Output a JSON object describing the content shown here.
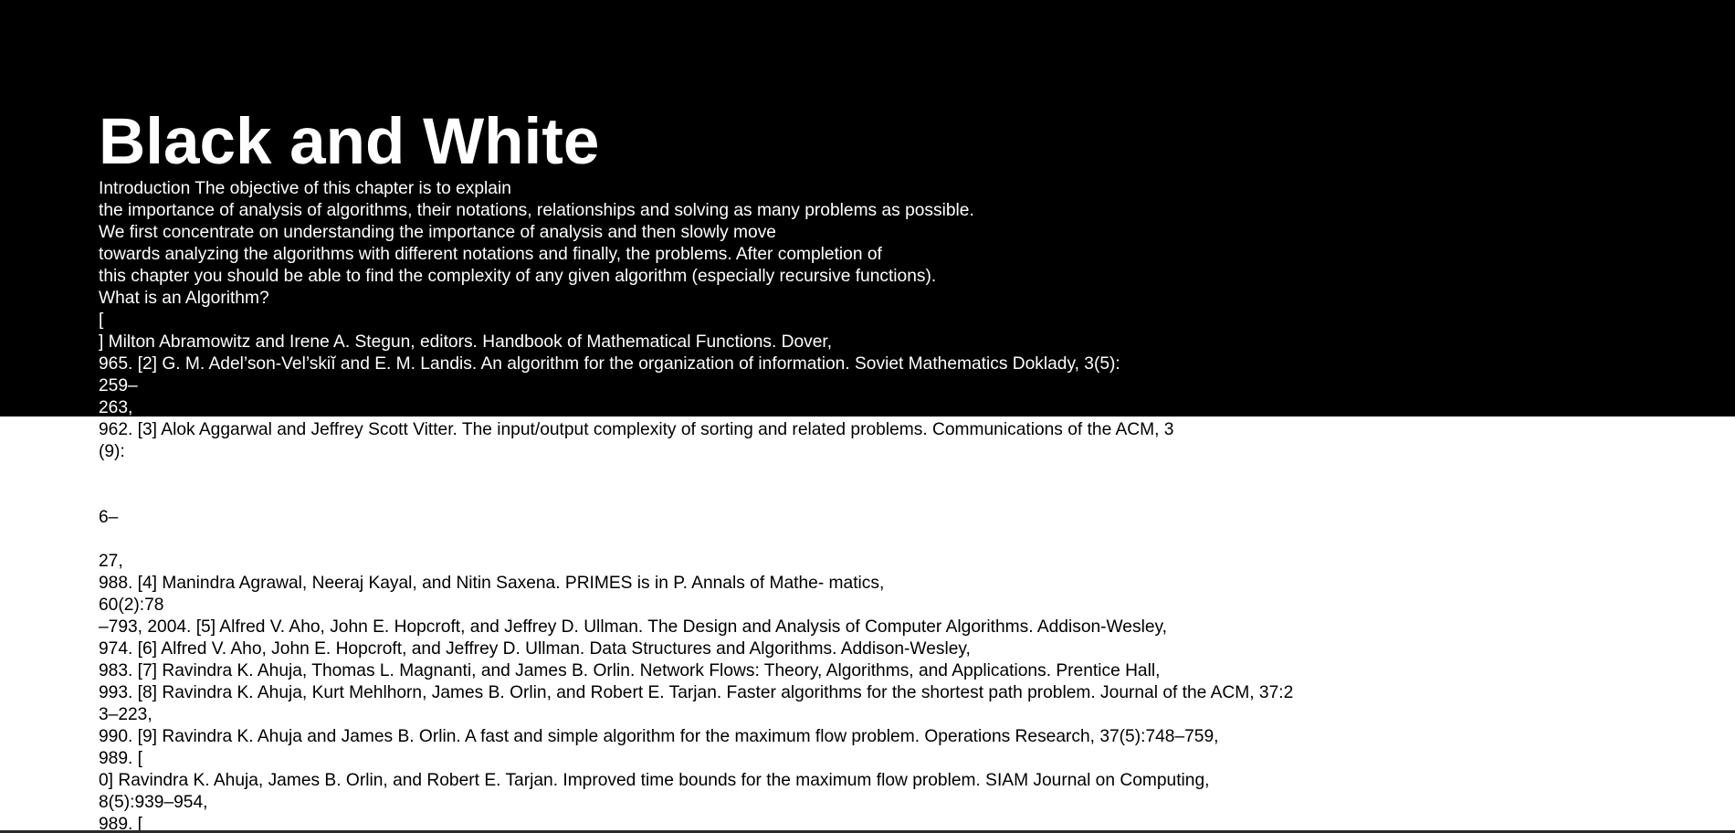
{
  "title": "Black and White",
  "colors": {
    "hero_background": "#000000",
    "hero_text": "#ffffff",
    "page_background": "#ffffff",
    "page_text": "#000000"
  },
  "lines": [
    "Introduction The objective of this chapter is to explain",
    "the importance of analysis of algorithms, their notations, relationships and solving as many problems as possible.",
    "We first concentrate on understanding the importance of analysis and then slowly move",
    "towards analyzing the algorithms with different notations and finally, the problems. After completion of",
    "this chapter you should be able to find the complexity of any given algorithm (especially recursive functions).",
    "What is an Algorithm?",
    "[",
    "] Milton Abramowitz and Irene A. Stegun, editors. Handbook of Mathematical Functions. Dover,",
    "965. [2] G. M. Adel’son-Vel’skiĭ and E. M. Landis. An algorithm for the organization of information. Soviet Mathematics Doklady, 3(5):",
    "259–",
    "263,",
    "962. [3] Alok Aggarwal and Jeffrey Scott Vitter. The input/output complexity of sorting and related problems. Communications of the ACM, 3",
    "(9):",
    "",
    "",
    "6–",
    "",
    "27,",
    "988. [4] Manindra Agrawal, Neeraj Kayal, and Nitin Saxena. PRIMES is in P. Annals of Mathe- matics,",
    "60(2):78",
    "–793, 2004. [5] Alfred V. Aho, John E. Hopcroft, and Jeffrey D. Ullman. The Design and Analysis of Computer Algorithms. Addison-Wesley,",
    "974. [6] Alfred V. Aho, John E. Hopcroft, and Jeffrey D. Ullman. Data Structures and Algorithms. Addison-Wesley,",
    "983. [7] Ravindra K. Ahuja, Thomas L. Magnanti, and James B. Orlin. Network Flows: Theory, Algorithms, and Applications. Prentice Hall,",
    "993. [8] Ravindra K. Ahuja, Kurt Mehlhorn, James B. Orlin, and Robert E. Tarjan. Faster algorithms for the shortest path problem. Journal of the ACM, 37:2",
    "3–223,",
    "990. [9] Ravindra K. Ahuja and James B. Orlin. A fast and simple algorithm for the maximum flow problem. Operations Research, 37(5):748–759,",
    "989. [",
    "0] Ravindra K. Ahuja, James B. Orlin, and Robert E. Tarjan. Improved time bounds for the maximum flow problem. SIAM Journal on Computing,",
    "8(5):939–954,",
    "989. ["
  ]
}
